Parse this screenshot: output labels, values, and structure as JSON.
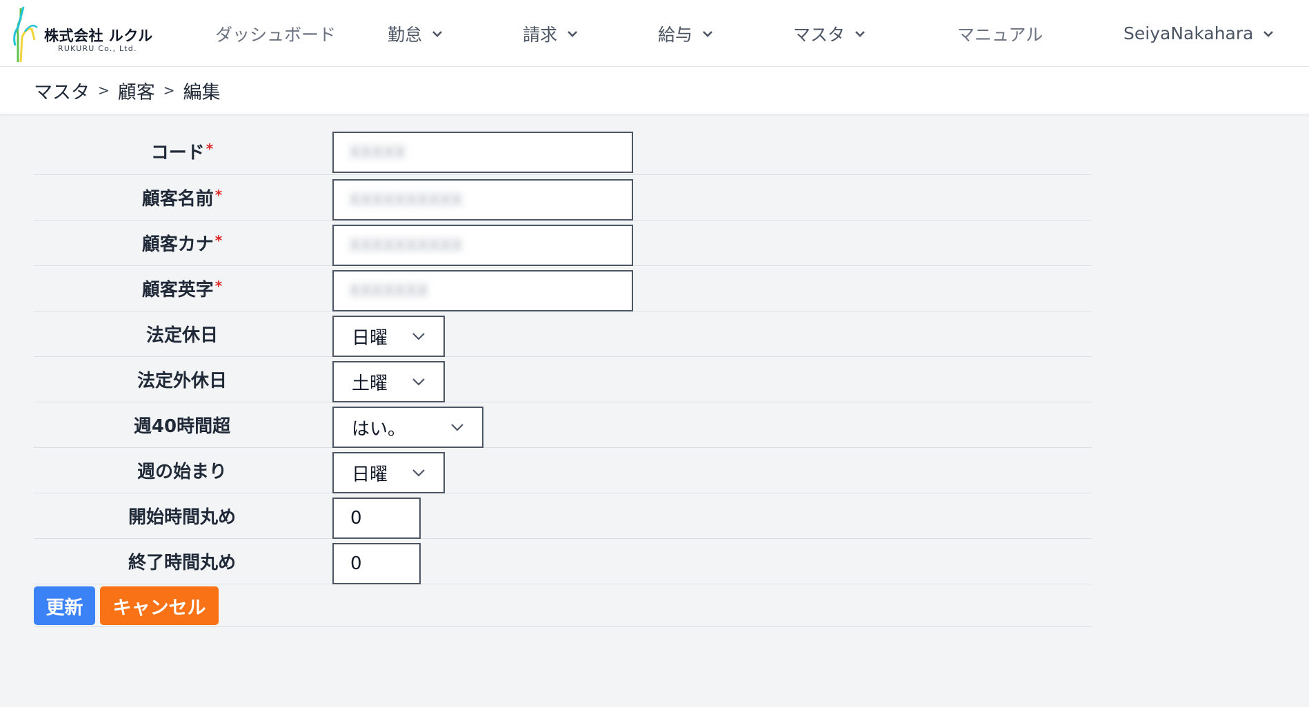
{
  "brand": {
    "company": "株式会社 ルクル",
    "english": "RUKURU Co., Ltd.",
    "accent_colors": [
      "#22c3d7",
      "#f0d43a",
      "#5fc24a"
    ]
  },
  "nav": {
    "dashboard": "ダッシュボード",
    "attendance": "勤怠",
    "billing": "請求",
    "payroll": "給与",
    "master": "マスタ",
    "manual": "マニュアル",
    "user": "SeiyaNakahara"
  },
  "breadcrumb": {
    "level1": "マスタ",
    "sep": ">",
    "level2": "顧客",
    "level3": "編集"
  },
  "form": {
    "required_mark": "*",
    "fields": {
      "code": {
        "label": "コード",
        "value": "XXXXX"
      },
      "customer_name": {
        "label": "顧客名前",
        "value": "XXXXXXXXXX"
      },
      "customer_kana": {
        "label": "顧客カナ",
        "value": "XXXXXXXXXX"
      },
      "customer_english": {
        "label": "顧客英字",
        "value": "XXXXXXX"
      },
      "legal_holiday": {
        "label": "法定休日",
        "value": "日曜"
      },
      "non_legal_holiday": {
        "label": "法定外休日",
        "value": "土曜"
      },
      "over_40h": {
        "label": "週40時間超",
        "value": "はい。"
      },
      "week_start": {
        "label": "週の始まり",
        "value": "日曜"
      },
      "start_rounding": {
        "label": "開始時間丸め",
        "value": "0"
      },
      "end_rounding": {
        "label": "終了時間丸め",
        "value": "0"
      }
    }
  },
  "actions": {
    "update": "更新",
    "cancel": "キャンセル",
    "update_color": "#3b82f6",
    "cancel_color": "#f97316"
  }
}
